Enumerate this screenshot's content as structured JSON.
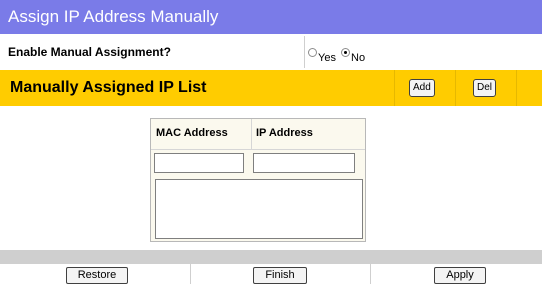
{
  "title": "Assign IP Address Manually",
  "enable": {
    "label": "Enable Manual Assignment?",
    "options": [
      {
        "label": "Yes",
        "checked": false
      },
      {
        "label": "No",
        "checked": true
      }
    ]
  },
  "list": {
    "title": "Manually Assigned IP List",
    "add_label": "Add",
    "del_label": "Del"
  },
  "table": {
    "mac_header": "MAC Address",
    "ip_header": "IP Address",
    "mac_value": "",
    "ip_value": ""
  },
  "buttons": {
    "restore": "Restore",
    "finish": "Finish",
    "apply": "Apply"
  },
  "colors": {
    "title_bar": "#7a7be8",
    "list_header": "#ffcc00",
    "footer_bar": "#cfcfcf"
  }
}
